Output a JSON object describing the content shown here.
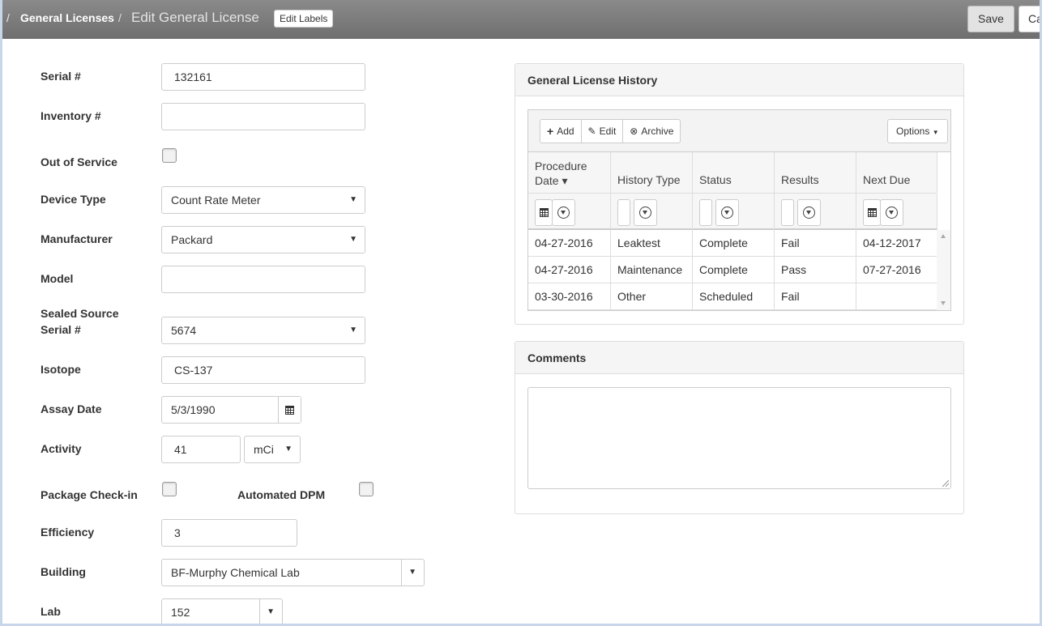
{
  "header": {
    "breadcrumb_sep": "/",
    "breadcrumb_link": "General Licenses",
    "breadcrumb_current": "Edit General License",
    "edit_labels": "Edit Labels",
    "save": "Save",
    "cancel": "Ca"
  },
  "form": {
    "serial_label": "Serial #",
    "serial_value": "132161",
    "inventory_label": "Inventory #",
    "inventory_value": "",
    "out_of_service_label": "Out of Service",
    "device_type_label": "Device Type",
    "device_type_value": "Count Rate Meter",
    "manufacturer_label": "Manufacturer",
    "manufacturer_value": "Packard",
    "model_label": "Model",
    "model_value": "",
    "sealed_source_label_1": "Sealed Source",
    "sealed_source_label_2": "Serial #",
    "sealed_source_value": "5674",
    "isotope_label": "Isotope",
    "isotope_value": "CS-137",
    "assay_date_label": "Assay Date",
    "assay_date_value": "5/3/1990",
    "activity_label": "Activity",
    "activity_value": "41",
    "activity_unit": "mCi",
    "package_checkin_label": "Package Check-in",
    "automated_dpm_label": "Automated DPM",
    "efficiency_label": "Efficiency",
    "efficiency_value": "3",
    "building_label": "Building",
    "building_value": "BF-Murphy Chemical Lab",
    "lab_label": "Lab",
    "lab_value": "152"
  },
  "history": {
    "title": "General License History",
    "toolbar": {
      "add": "Add",
      "edit": "Edit",
      "archive": "Archive",
      "options": "Options"
    },
    "columns": [
      "Procedure Date",
      "History Type",
      "Status",
      "Results",
      "Next Due"
    ],
    "col_procedure_1": "Procedure",
    "col_procedure_2": "Date",
    "sort_indicator": "▾",
    "rows": [
      {
        "date": "04-27-2016",
        "type": "Leaktest",
        "status": "Complete",
        "result": "Fail",
        "next_due": "04-12-2017"
      },
      {
        "date": "04-27-2016",
        "type": "Maintenance",
        "status": "Complete",
        "result": "Pass",
        "next_due": "07-27-2016"
      },
      {
        "date": "03-30-2016",
        "type": "Other",
        "status": "Scheduled",
        "result": "Fail",
        "next_due": ""
      }
    ]
  },
  "comments": {
    "title": "Comments",
    "value": ""
  },
  "icons": {
    "calendar": "calendar-icon",
    "caret": "caret-down-icon",
    "filter": "filter-icon",
    "plus": "plus-icon",
    "pencil": "pencil-icon",
    "archive": "close-circle-icon"
  }
}
